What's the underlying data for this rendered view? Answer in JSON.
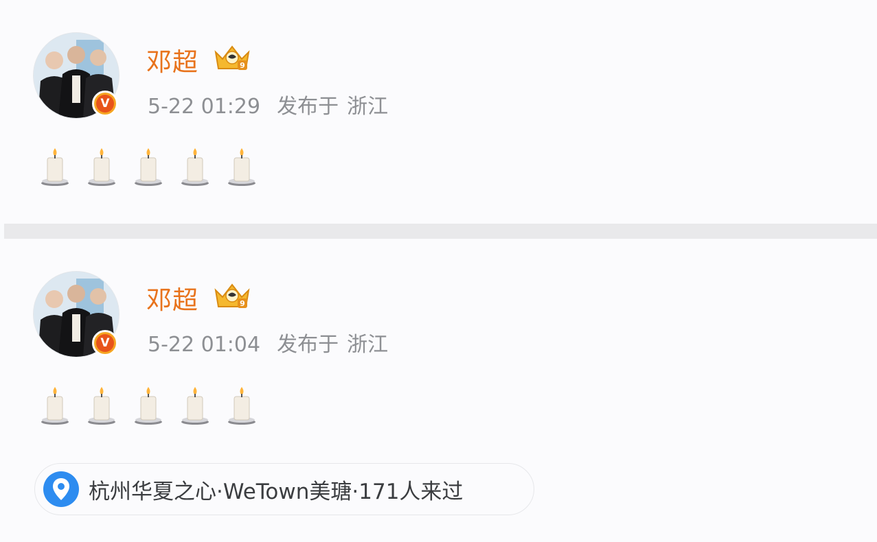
{
  "posts": [
    {
      "username": "邓超",
      "time": "5-22 01:29",
      "published_label": "发布于",
      "region": "浙江",
      "content_icons": [
        "candle-icon",
        "candle-icon",
        "candle-icon",
        "candle-icon",
        "candle-icon"
      ]
    },
    {
      "username": "邓超",
      "time": "5-22 01:04",
      "published_label": "发布于",
      "region": "浙江",
      "content_icons": [
        "candle-icon",
        "candle-icon",
        "candle-icon",
        "candle-icon",
        "candle-icon"
      ],
      "location": {
        "icon": "location-pin-icon",
        "name": "杭州华夏之心·WeTown美瑭",
        "visits": "·171人来过"
      }
    }
  ],
  "badges": {
    "verified_letter": "V",
    "crown_level": "9"
  },
  "colors": {
    "username": "#e8731c",
    "meta": "#8d8f93",
    "pin": "#2d8cf0",
    "divider": "#e9e9eb",
    "verified_badge": "#e8541a"
  }
}
